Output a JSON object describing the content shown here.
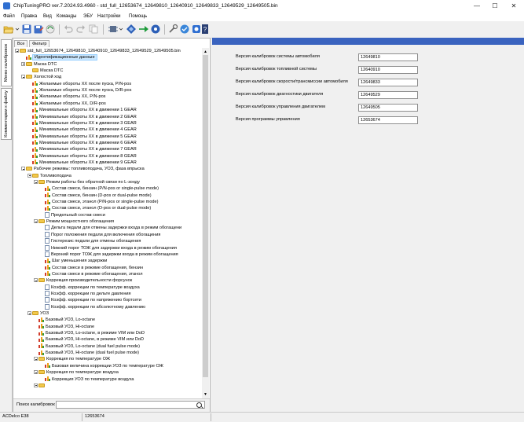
{
  "window": {
    "title": "ChipTuningPRO ver.7.2024.93.4960 - std_full_12653674_12649810_12640910_12649833_12649529_12649505.bin",
    "minimize": "—",
    "maximize": "☐",
    "close": "✕"
  },
  "menu": [
    "Файл",
    "Правка",
    "Вид",
    "Команды",
    "ЭБУ",
    "Настройки",
    "Помощь"
  ],
  "toolbar_icons": [
    "open-folder-icon",
    "save-icon",
    "save-as-icon",
    "undo-icon",
    "redo-icon",
    "copy-icon",
    "paste-icon",
    "compare-icon",
    "write-icon",
    "read-icon",
    "checksum-icon",
    "tools-icon",
    "help-icon"
  ],
  "side_tabs": [
    "Меню калибровок",
    "Комментарии к файлу"
  ],
  "top_tabs": [
    "Все",
    "Фильтр"
  ],
  "tree": [
    {
      "l": 0,
      "i": "folder",
      "t": "std_full_12653674_12649810_12640910_12649833_12649529_12649505.bin",
      "tg": 1
    },
    {
      "l": 1,
      "i": "chart",
      "t": "Идентификационные данные",
      "sel": 1
    },
    {
      "l": 1,
      "i": "folder",
      "t": "Маска DTC",
      "tg": 1
    },
    {
      "l": 2,
      "i": "folder",
      "t": "Маска DTC"
    },
    {
      "l": 1,
      "i": "folder",
      "t": "Холостой ход",
      "tg": 1
    },
    {
      "l": 2,
      "i": "chart",
      "t": "Желаемые обороты ХХ после пуска, P/N-pos"
    },
    {
      "l": 2,
      "i": "chart",
      "t": "Желаемые обороты ХХ после пуска, D/R-pos"
    },
    {
      "l": 2,
      "i": "chart",
      "t": "Желаемые обороты ХХ, P/N-pos"
    },
    {
      "l": 2,
      "i": "chart",
      "t": "Желаемые обороты ХХ, D/R-pos"
    },
    {
      "l": 2,
      "i": "chart",
      "t": "Минимальные обороты ХХ в движении 1 GEAR"
    },
    {
      "l": 2,
      "i": "chart",
      "t": "Минимальные обороты ХХ в движении 2 GEAR"
    },
    {
      "l": 2,
      "i": "chart",
      "t": "Минимальные обороты ХХ в движении 3 GEAR"
    },
    {
      "l": 2,
      "i": "chart",
      "t": "Минимальные обороты ХХ в движении 4 GEAR"
    },
    {
      "l": 2,
      "i": "chart",
      "t": "Минимальные обороты ХХ в движении 5 GEAR"
    },
    {
      "l": 2,
      "i": "chart",
      "t": "Минимальные обороты ХХ в движении 6 GEAR"
    },
    {
      "l": 2,
      "i": "chart",
      "t": "Минимальные обороты ХХ в движении 7 GEAR"
    },
    {
      "l": 2,
      "i": "chart",
      "t": "Минимальные обороты ХХ в движении 8 GEAR"
    },
    {
      "l": 2,
      "i": "chart",
      "t": "Минимальные обороты ХХ в движении 9 GEAR"
    },
    {
      "l": 1,
      "i": "folder",
      "t": "Рабочие режимы: топливоподача, УОЗ, фаза впрыска",
      "tg": 1
    },
    {
      "l": 2,
      "i": "folder",
      "t": "Топливоподача",
      "tg": 1
    },
    {
      "l": 3,
      "i": "folder",
      "t": "Режим работы без обратной связи по L-зонду",
      "tg": 1
    },
    {
      "l": 4,
      "i": "chart",
      "t": "Состав смеси, бензин (P/N-pos or single-pulse mode)"
    },
    {
      "l": 4,
      "i": "chart",
      "t": "Состав смеси, бензин (D-pos or dual-pulse mode)"
    },
    {
      "l": 4,
      "i": "chart",
      "t": "Состав смеси, этанол (P/N-pos or single-pulse mode)"
    },
    {
      "l": 4,
      "i": "chart",
      "t": "Состав смеси, этанол (D-pos or dual-pulse mode)"
    },
    {
      "l": 4,
      "i": "doc",
      "t": "Предельный состав смеси"
    },
    {
      "l": 3,
      "i": "folder",
      "t": "Режим мощностного обогащения",
      "tg": 1
    },
    {
      "l": 4,
      "i": "doc",
      "t": "Дельта педали для отмены задержки входа в режим обогащени"
    },
    {
      "l": 4,
      "i": "doc",
      "t": "Порог положения педали для включения обогащения"
    },
    {
      "l": 4,
      "i": "doc",
      "t": "Гистерезис педали для отмены обогащения"
    },
    {
      "l": 4,
      "i": "doc",
      "t": "Нижний порог ТОЖ для задержки входа в режим обогащения"
    },
    {
      "l": 4,
      "i": "doc",
      "t": "Верхний порог ТОЖ для задержки входа в режим обогащения"
    },
    {
      "l": 4,
      "i": "chart",
      "t": "Шаг уменьшения задержки"
    },
    {
      "l": 4,
      "i": "chart",
      "t": "Состав смеси в режиме обогащения, бензин"
    },
    {
      "l": 4,
      "i": "chart",
      "t": "Состав смеси в режиме обогащения, этанол"
    },
    {
      "l": 3,
      "i": "folder",
      "t": "Коррекция производительности форсунок",
      "tg": 1
    },
    {
      "l": 4,
      "i": "doc",
      "t": "Коэфф. коррекции по температуре воздуха"
    },
    {
      "l": 4,
      "i": "doc",
      "t": "Коэфф. коррекции по дельте давления"
    },
    {
      "l": 4,
      "i": "doc",
      "t": "Коэфф. коррекции по напряжению бортсети"
    },
    {
      "l": 4,
      "i": "doc",
      "t": "Коэфф. коррекции по абсолютному давлению"
    },
    {
      "l": 2,
      "i": "folder",
      "t": "УОЗ",
      "tg": 1
    },
    {
      "l": 3,
      "i": "chart",
      "t": "Базовый УОЗ, Lo-octane"
    },
    {
      "l": 3,
      "i": "chart",
      "t": "Базовый УОЗ, Hi-octane"
    },
    {
      "l": 3,
      "i": "chart",
      "t": "Базовый УОЗ, Lo-octane, в режиме VIM или DoD"
    },
    {
      "l": 3,
      "i": "chart",
      "t": "Базовый УОЗ, Hi-octane, в режиме VIM или DoD"
    },
    {
      "l": 3,
      "i": "chart",
      "t": "Базовый УОЗ, Lo-octane (dual fuel pulse mode)"
    },
    {
      "l": 3,
      "i": "chart",
      "t": "Базовый УОЗ, Hi-octane (dual fuel pulse mode)"
    },
    {
      "l": 3,
      "i": "folder",
      "t": "Коррекция по температуре ОЖ",
      "tg": 1
    },
    {
      "l": 4,
      "i": "chart",
      "t": "Базовая величина коррекции УОЗ по температуре ОЖ"
    },
    {
      "l": 3,
      "i": "folder",
      "t": "Коррекция по температуре воздуха",
      "tg": 1
    },
    {
      "l": 4,
      "i": "chart",
      "t": "Коррекция УОЗ по температуре воздуха"
    },
    {
      "l": 3,
      "i": "folder",
      "t": "",
      "tg": 1
    }
  ],
  "search": {
    "label": "Поиск калибровок",
    "value": ""
  },
  "fields": [
    {
      "label": "Версия калибровок системы автомобиля",
      "value": "12649810"
    },
    {
      "label": "Версия калибровок топливной системы",
      "value": "12640910"
    },
    {
      "label": "Версия калибровок скорости/трансмиссии автомобиля",
      "value": "12649833"
    },
    {
      "label": "Версия калибровок диагностики двигателя",
      "value": "12649529"
    },
    {
      "label": "Версия калибровок управления двигателем",
      "value": "12649505"
    },
    {
      "label": "Версия программы управления",
      "value": "12653674"
    }
  ],
  "status": {
    "ecu": "ACDelco E38",
    "id": "12653674"
  }
}
